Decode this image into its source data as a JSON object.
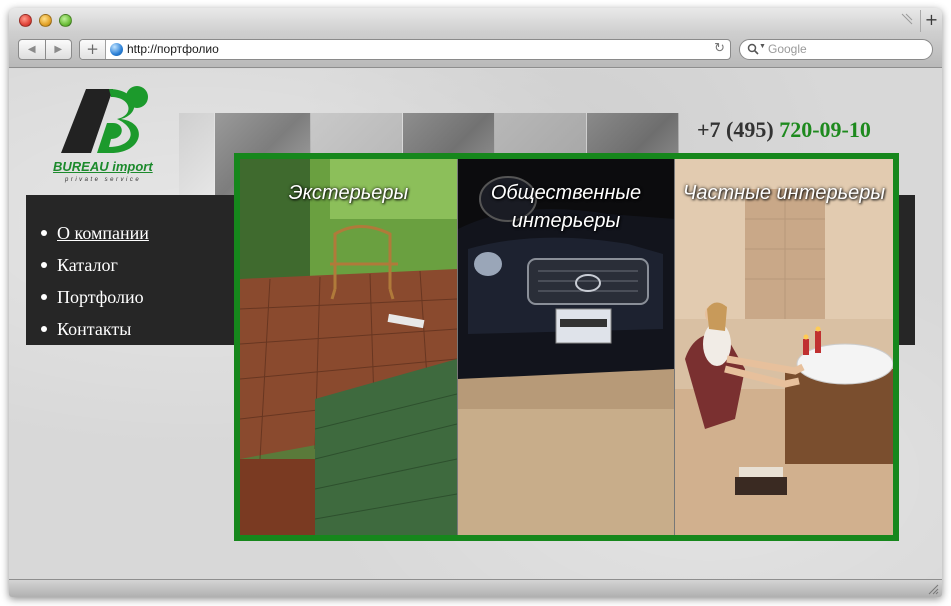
{
  "browser": {
    "new_tab_label": "+",
    "back_glyph": "◀",
    "forward_glyph": "▶",
    "add_bookmark_label": "+",
    "url": "http://портфолио",
    "reload_glyph": "↻",
    "search_placeholder": "Google",
    "icons": [
      "globe-icon",
      "search-icon",
      "reload-icon",
      "back-icon",
      "forward-icon"
    ]
  },
  "site": {
    "logo": {
      "title": "BUREAU import",
      "subtitle": "private service",
      "colors": {
        "dark": "#222222",
        "green": "#1c9a2c"
      }
    },
    "phone": {
      "prefix": "+7 (495)",
      "number": "720-09-10"
    },
    "menu": [
      {
        "label": "О компании",
        "active": true
      },
      {
        "label": "Каталог",
        "active": false
      },
      {
        "label": "Портфолио",
        "active": false
      },
      {
        "label": "Контакты",
        "active": false
      }
    ],
    "gallery": [
      {
        "title": "Экстерьеры"
      },
      {
        "title": "Общественные интерьеры"
      },
      {
        "title": "Частные интерьеры"
      }
    ],
    "accent_color": "#16871c"
  }
}
